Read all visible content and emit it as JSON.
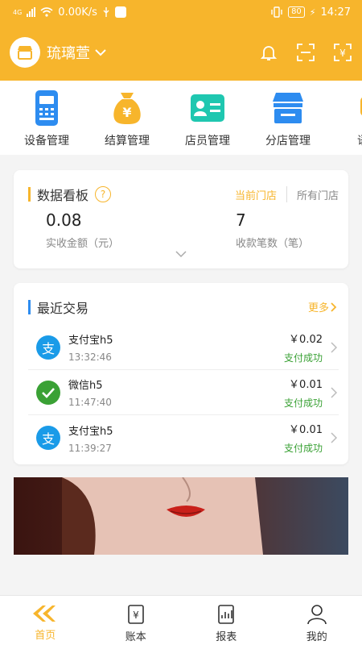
{
  "status_bar": {
    "network": "4G",
    "speed": "0.00K/s",
    "battery": "80",
    "time": "14:27"
  },
  "header": {
    "store_name": "琉璃萱"
  },
  "quick_menu": [
    {
      "label": "设备管理",
      "icon": "pos-terminal-icon",
      "color": "#2d8cf0"
    },
    {
      "label": "结算管理",
      "icon": "money-bag-icon",
      "color": "#f7b52c"
    },
    {
      "label": "店员管理",
      "icon": "id-card-icon",
      "color": "#1fc7b0"
    },
    {
      "label": "分店管理",
      "icon": "store-icon",
      "color": "#2d8cf0"
    },
    {
      "label": "语音",
      "icon": "voice-icon",
      "color": "#f7b52c"
    }
  ],
  "dashboard": {
    "title": "数据看板",
    "help": "?",
    "tab_current": "当前门店",
    "tab_all": "所有门店",
    "amount_value": "0.08",
    "amount_label": "实收金额（元）",
    "count_value": "7",
    "count_label": "收款笔数（笔）"
  },
  "recent": {
    "title": "最近交易",
    "more": "更多",
    "transactions": [
      {
        "name": "支付宝h5",
        "time": "13:32:46",
        "amount": "￥0.02",
        "status": "支付成功",
        "method": "alipay"
      },
      {
        "name": "微信h5",
        "time": "11:47:40",
        "amount": "￥0.01",
        "status": "支付成功",
        "method": "wechat"
      },
      {
        "name": "支付宝h5",
        "time": "11:39:27",
        "amount": "￥0.01",
        "status": "支付成功",
        "method": "alipay"
      }
    ]
  },
  "bottom_nav": [
    {
      "label": "首页",
      "active": true
    },
    {
      "label": "账本",
      "active": false
    },
    {
      "label": "报表",
      "active": false
    },
    {
      "label": "我的",
      "active": false
    }
  ],
  "colors": {
    "brand": "#f7b52c",
    "blue": "#2d8cf0",
    "alipay": "#1a9be8",
    "wechat": "#3aa135",
    "success": "#3aa135"
  }
}
